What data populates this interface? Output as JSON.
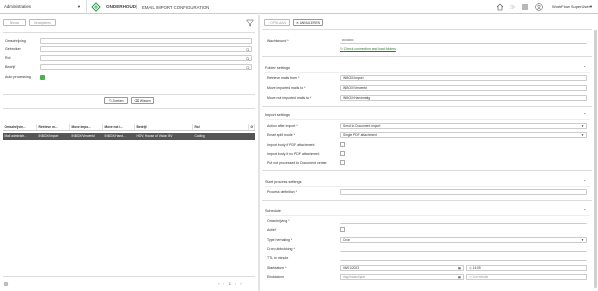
{
  "topbar": {
    "company": "Administraties",
    "breadcrumb_module": "ONDERHOUD",
    "breadcrumb_sep": "|",
    "breadcrumb_page": "EMAIL IMPORT CONFIGURATION",
    "user": "WorkFlow SuperUser"
  },
  "left": {
    "toolbar": {
      "new_label": "Nieuw",
      "delete_label": "Verwijderen"
    },
    "filters": [
      {
        "label": "Omschrijving"
      },
      {
        "label": "Gebruiker"
      },
      {
        "label": "Rol"
      },
      {
        "label": "Bedrijf"
      }
    ],
    "auto_processing_label": "Auto processing",
    "search_label": "Zoeken",
    "clear_label": "Wissen",
    "table": {
      "headers": [
        "Omschrijvin...",
        "Retrieve m...",
        "Move impo...",
        "Move not i...",
        "Bedrijf",
        "Rol",
        "G"
      ],
      "rows": [
        [
          "Mail administr...",
          "INBOX/Import",
          "INBOX/Verwerkt",
          "INBOX/Hand...",
          "HOV; House of Vision BV",
          "Coding",
          ""
        ]
      ]
    },
    "pager": {
      "first": "«",
      "prev": "‹",
      "page": "1",
      "next": "›",
      "last": "»"
    }
  },
  "right": {
    "toolbar": {
      "save_label": "OPSLAAN",
      "cancel_label": "ANNULEREN"
    },
    "password_label": "Wachtwoord *",
    "password_value": "••••••••••",
    "check_link": "Check connection and load folders",
    "folder_settings": {
      "title": "Folder settings",
      "fields": [
        {
          "label": "Retrieve mails from *",
          "value": "INBOX/Import"
        },
        {
          "label": "Move imported mails to *",
          "value": "INBOX/Verwerkt"
        },
        {
          "label": "Move not imported mails to *",
          "value": "INBOX/Handmatig"
        }
      ]
    },
    "import_settings": {
      "title": "Import settings",
      "action_after_import_label": "Action after import *",
      "action_after_import_value": "Send to Document import",
      "email_split_label": "Email split mode *",
      "email_split_value": "Single PDF attachment",
      "checks": [
        {
          "label": "Import body if PDF attachment"
        },
        {
          "label": "Import body if no PDF attachment"
        },
        {
          "label": "Put not processed to Document center"
        }
      ]
    },
    "start_process": {
      "title": "Start process settings",
      "process_definition_label": "Process definition *"
    },
    "schedule": {
      "title": "Schedule",
      "description_label": "Omschrijving *",
      "active_label": "Actief",
      "repeat_type_label": "Type herhaling *",
      "repeat_type_value": "Cron",
      "cron_label": "Cron uitdrukking *",
      "ttl_label": "TTL in minute",
      "start_label": "Startdatum *",
      "start_date": "06/01/2023",
      "start_time": "14:05",
      "end_label": "Einddatum",
      "end_date": "dag/maand/jaar",
      "end_time": "Uur:minute"
    }
  }
}
